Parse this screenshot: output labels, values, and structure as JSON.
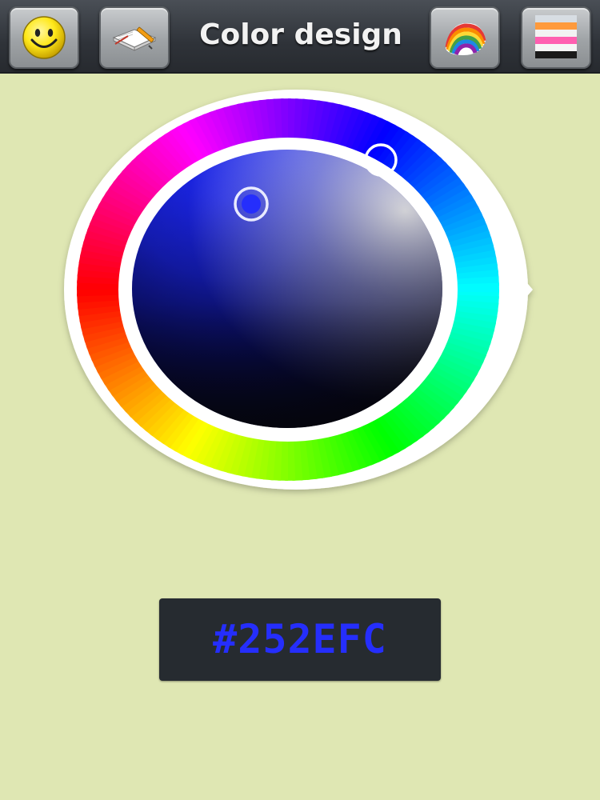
{
  "header": {
    "title": "Color design",
    "left_buttons": [
      {
        "icon": "smiley-face-icon"
      },
      {
        "icon": "open-book-pencil-icon"
      }
    ],
    "right_buttons": [
      {
        "icon": "rainbow-palette-icon"
      },
      {
        "icon": "color-swatches-icon"
      }
    ]
  },
  "picker": {
    "selected_color": "#252EFC",
    "hue_color": "#0a1aff"
  },
  "hex_display": {
    "value": "#252EFC"
  },
  "colors": {
    "background": "#dfe7b3",
    "toolbar": "#2f3339",
    "hex_panel": "#262b30",
    "hex_text": "#252efc"
  }
}
